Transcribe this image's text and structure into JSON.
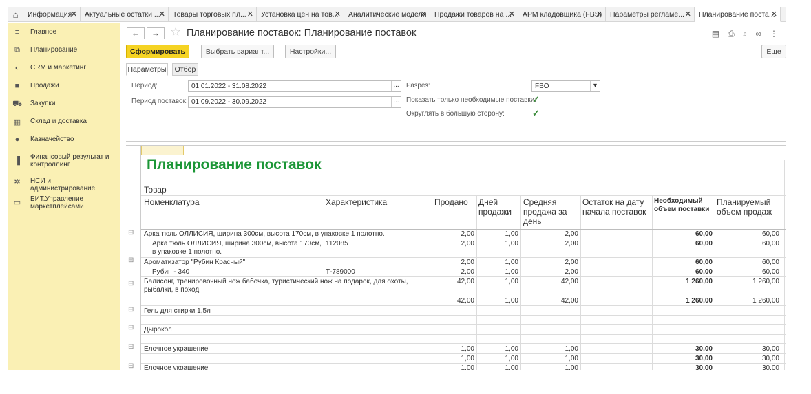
{
  "tabs": [
    {
      "label": "Информация",
      "active": false
    },
    {
      "label": "Актуальные остатки ...",
      "active": false
    },
    {
      "label": "Товары торговых пл...",
      "active": false
    },
    {
      "label": "Установка цен на тов...",
      "active": false
    },
    {
      "label": "Аналитические модели",
      "active": false
    },
    {
      "label": "Продажи товаров на ...",
      "active": false
    },
    {
      "label": "АРМ кладовщика (FBS)",
      "active": false
    },
    {
      "label": "Параметры регламе...",
      "active": false
    },
    {
      "label": "Планирование поста...",
      "active": true
    }
  ],
  "sidebar": {
    "items": [
      {
        "label": "Главное",
        "icon": "menu-icon"
      },
      {
        "label": "Планирование",
        "icon": "planning-icon"
      },
      {
        "label": "CRM и маркетинг",
        "icon": "crm-icon"
      },
      {
        "label": "Продажи",
        "icon": "bag-icon"
      },
      {
        "label": "Закупки",
        "icon": "cart-icon"
      },
      {
        "label": "Склад и доставка",
        "icon": "warehouse-icon"
      },
      {
        "label": "Казначейство",
        "icon": "coin-icon"
      },
      {
        "label": "Финансовый результат и контроллинг",
        "icon": "chart-icon"
      },
      {
        "label": "НСИ и администрирование",
        "icon": "gear-icon"
      },
      {
        "label": "БИТ.Управление маркетплейсами",
        "icon": "chat-icon"
      }
    ]
  },
  "window": {
    "title": "Планирование поставок: Планирование поставок"
  },
  "toolbar": {
    "generate": "Сформировать",
    "choose_variant": "Выбрать вариант...",
    "settings": "Настройки...",
    "more": "Еще"
  },
  "param_tabs": {
    "params": "Параметры",
    "filter": "Отбор"
  },
  "params": {
    "period_label": "Период:",
    "period_value": "01.01.2022 - 31.08.2022",
    "supply_period_label": "Период поставок:",
    "supply_period_value": "01.09.2022 - 30.09.2022",
    "section_label": "Разрез:",
    "section_value": "FBO",
    "only_needed_label": "Показать только необходимые поставки:",
    "round_up_label": "Округлять в большую сторону:",
    "only_needed_checked": true,
    "round_up_checked": true
  },
  "report": {
    "title": "Планирование поставок",
    "group_header": "Товар",
    "columns": {
      "nomenclature": "Номенклатура",
      "characteristic": "Характеристика",
      "sold": "Продано",
      "days": "Дней продажи",
      "avg": "Средняя продажа за день",
      "stock": "Остаток на дату начала поставок",
      "needed": "Необходимый объем поставки",
      "planned": "Планируемый объем продаж"
    },
    "rows": [
      {
        "name": "Арка тюль ОЛЛИСИЯ, ширина 300см, высота 170см, в упаковке 1 полотно.",
        "name2": "",
        "char": "",
        "sold": "2,00",
        "days": "1,00",
        "avg": "2,00",
        "stock": "",
        "needed": "60,00",
        "planned": "60,00",
        "group": true
      },
      {
        "name": "Арка тюль ОЛЛИСИЯ, ширина 300см, высота 170см,",
        "name2": "в упаковке 1 полотно.",
        "char": "112085",
        "sold": "2,00",
        "days": "1,00",
        "avg": "2,00",
        "stock": "",
        "needed": "60,00",
        "planned": "60,00",
        "group": false
      },
      {
        "name": "Ароматизатор \"Рубин Красный\"",
        "name2": "",
        "char": "",
        "sold": "2,00",
        "days": "1,00",
        "avg": "2,00",
        "stock": "",
        "needed": "60,00",
        "planned": "60,00",
        "group": true
      },
      {
        "name": "Рубин - 340",
        "name2": "",
        "char": "Т-789000",
        "sold": "2,00",
        "days": "1,00",
        "avg": "2,00",
        "stock": "",
        "needed": "60,00",
        "planned": "60,00",
        "group": false
      },
      {
        "name": "Балисонг, тренировочный нож бабочка, туристический нож на подарок, для охоты,",
        "name2": "рыбалки, в поход.",
        "char": "",
        "sold": "42,00",
        "days": "1,00",
        "avg": "42,00",
        "stock": "",
        "needed": "1 260,00",
        "planned": "1 260,00",
        "group": true
      },
      {
        "name": "",
        "name2": "",
        "char": "",
        "sold": "42,00",
        "days": "1,00",
        "avg": "42,00",
        "stock": "",
        "needed": "1 260,00",
        "planned": "1 260,00",
        "group": false
      },
      {
        "name": "Гель для стирки 1,5л",
        "name2": "",
        "char": "",
        "sold": "",
        "days": "",
        "avg": "",
        "stock": "",
        "needed": "",
        "planned": "",
        "group": true
      },
      {
        "name": "Дырокол",
        "name2": "",
        "char": "",
        "sold": "",
        "days": "",
        "avg": "",
        "stock": "",
        "needed": "",
        "planned": "",
        "group": true
      },
      {
        "name": "Елочное украшение",
        "name2": "",
        "char": "",
        "sold": "1,00",
        "days": "1,00",
        "avg": "1,00",
        "stock": "",
        "needed": "30,00",
        "planned": "30,00",
        "group": true
      },
      {
        "name": "",
        "name2": "",
        "char": "",
        "sold": "1,00",
        "days": "1,00",
        "avg": "1,00",
        "stock": "",
        "needed": "30,00",
        "planned": "30,00",
        "group": false
      },
      {
        "name": "Елочное украшение",
        "name2": "",
        "char": "",
        "sold": "1,00",
        "days": "1,00",
        "avg": "1,00",
        "stock": "",
        "needed": "30,00",
        "planned": "30,00",
        "group": true
      }
    ]
  }
}
